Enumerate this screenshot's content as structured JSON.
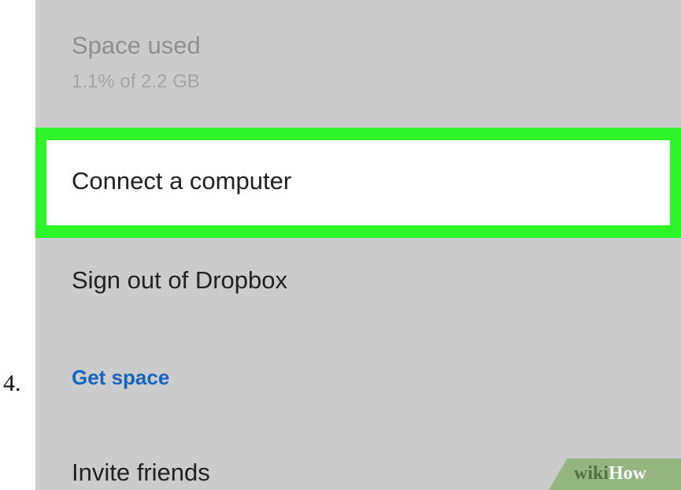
{
  "step": {
    "number": "4."
  },
  "menu": {
    "space_used": {
      "title": "Space used",
      "subtitle": "1.1% of 2.2 GB"
    },
    "connect_computer": "Connect a computer",
    "sign_out": "Sign out of Dropbox",
    "get_space": "Get space",
    "invite_friends": "Invite friends"
  },
  "watermark": {
    "wiki": "wiki",
    "how": "How"
  },
  "colors": {
    "highlight": "#2ef52a",
    "link": "#1565c0",
    "background": "#cbcbcb"
  }
}
